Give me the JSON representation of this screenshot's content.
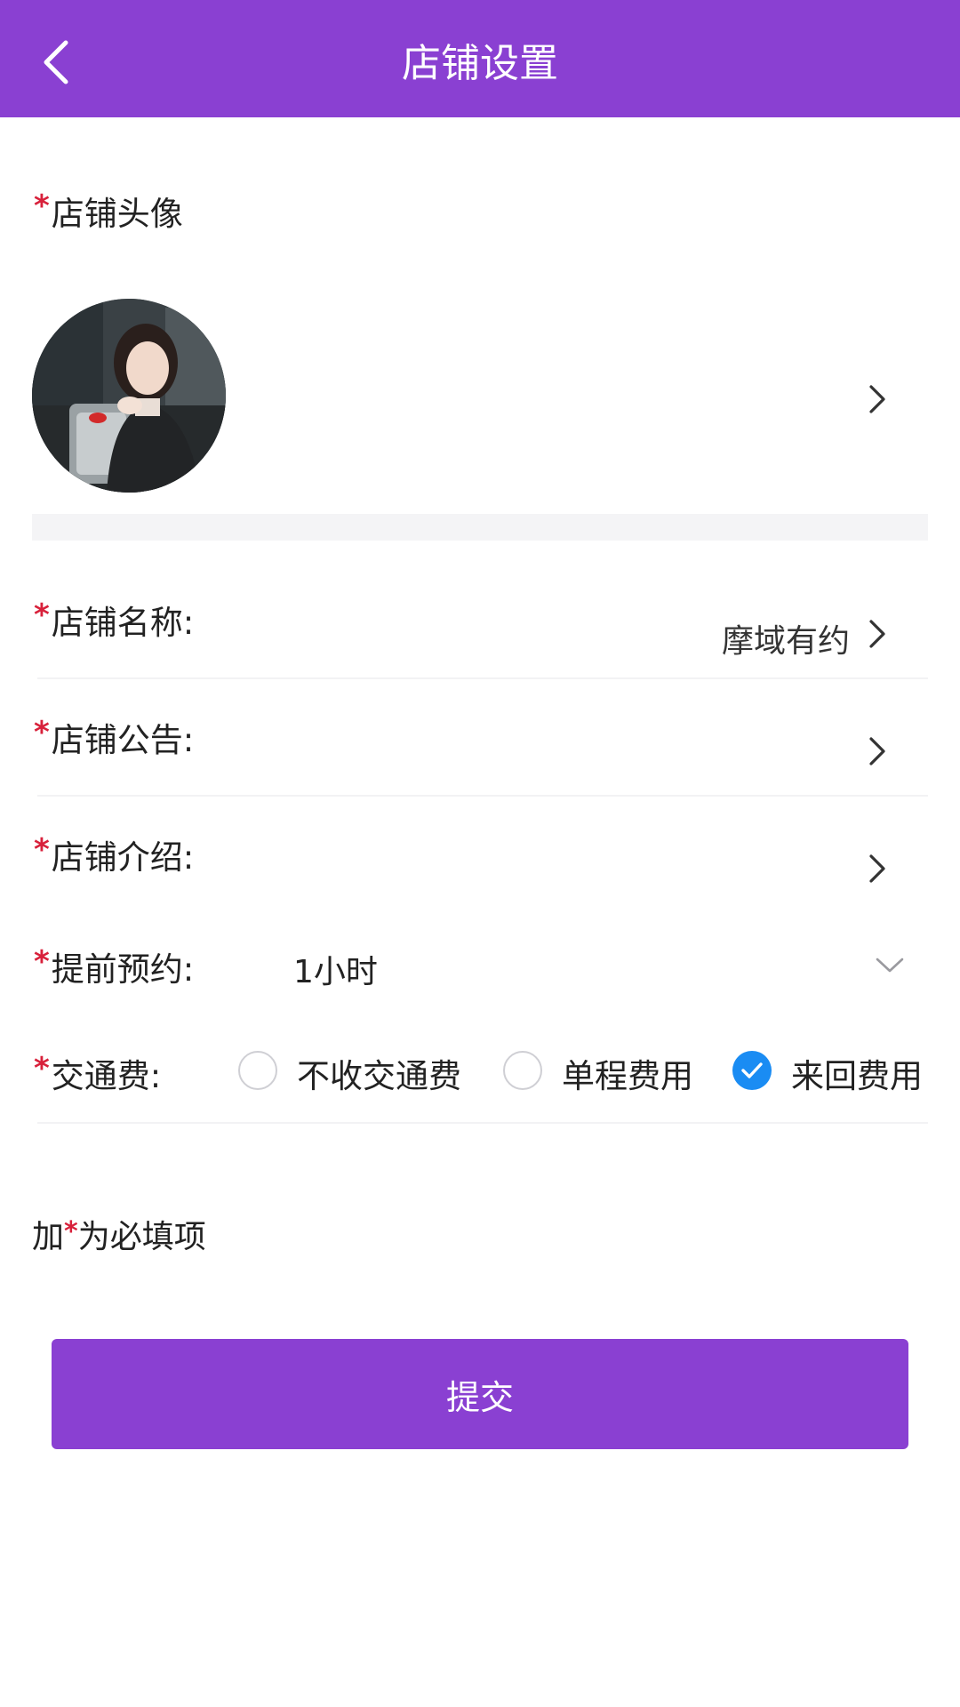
{
  "header": {
    "title": "店铺设置"
  },
  "required_mark": "*",
  "avatar_row": {
    "label": "店铺头像"
  },
  "name_row": {
    "label": "店铺名称:",
    "value": "摩域有约"
  },
  "notice_row": {
    "label": "店铺公告:",
    "value": ""
  },
  "intro_row": {
    "label": "店铺介绍:",
    "value": ""
  },
  "advance_row": {
    "label": "提前预约:",
    "selected": "1小时"
  },
  "fee_row": {
    "label": "交通费:",
    "options": [
      {
        "label": "不收交通费",
        "checked": false
      },
      {
        "label": "单程费用",
        "checked": false
      },
      {
        "label": "来回费用",
        "checked": true
      }
    ]
  },
  "note": {
    "prefix": "加",
    "star": "*",
    "suffix": "为必填项"
  },
  "submit": {
    "label": "提交"
  },
  "colors": {
    "header_bg": "#8a40d2",
    "required": "#d8213b",
    "radio_checked": "#1a8cf3",
    "button_bg": "#8a40d2"
  },
  "icons": [
    "back-arrow-icon",
    "chevron-right-icon",
    "chevron-down-icon",
    "check-icon"
  ]
}
